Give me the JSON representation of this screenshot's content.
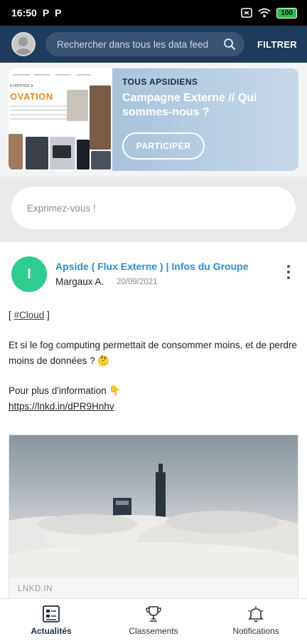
{
  "status_bar": {
    "time": "16:50",
    "notif_marks": [
      "P",
      "P"
    ],
    "battery": "100"
  },
  "header": {
    "search_placeholder": "Rechercher dans tous les data feed",
    "filter_label": "FILTRER"
  },
  "banner": {
    "label": "TOUS APSIDIENS",
    "title": "Campagne Externe // Qui sommes-nous ?",
    "cta": "PARTICIPER",
    "thumb_text": "OVATION",
    "colors": {
      "thumb_title": "#e98a2b",
      "panel": "#b9cde0"
    }
  },
  "compose": {
    "placeholder": "Exprimez-vous !"
  },
  "post": {
    "avatar_letter": "I",
    "source": "Apside ( Flux Externe ) | Infos du Groupe",
    "author": "Margaux A.",
    "date": "20/09/2021",
    "tag_prefix": "[ ",
    "tag": "#Cloud",
    "tag_suffix": " ]",
    "paragraph": "Et si le fog computing permettait de consommer moins, et de perdre moins de données ? 🤔",
    "more_info": "Pour plus d'information 👇",
    "link": "https://lnkd.in/dPR9Hnhv",
    "link_domain": "LNKD.IN",
    "colors": {
      "avatar": "#2ecc8f",
      "source": "#2a8ec9"
    }
  },
  "bottom_nav": {
    "items": [
      {
        "label": "Actualités",
        "icon": "news-icon",
        "active": true
      },
      {
        "label": "Classements",
        "icon": "trophy-icon",
        "active": false
      },
      {
        "label": "Notifications",
        "icon": "bell-icon",
        "active": false
      }
    ]
  },
  "colors": {
    "header_bg": "#1e3a5c",
    "search_bg": "#3a5373"
  }
}
